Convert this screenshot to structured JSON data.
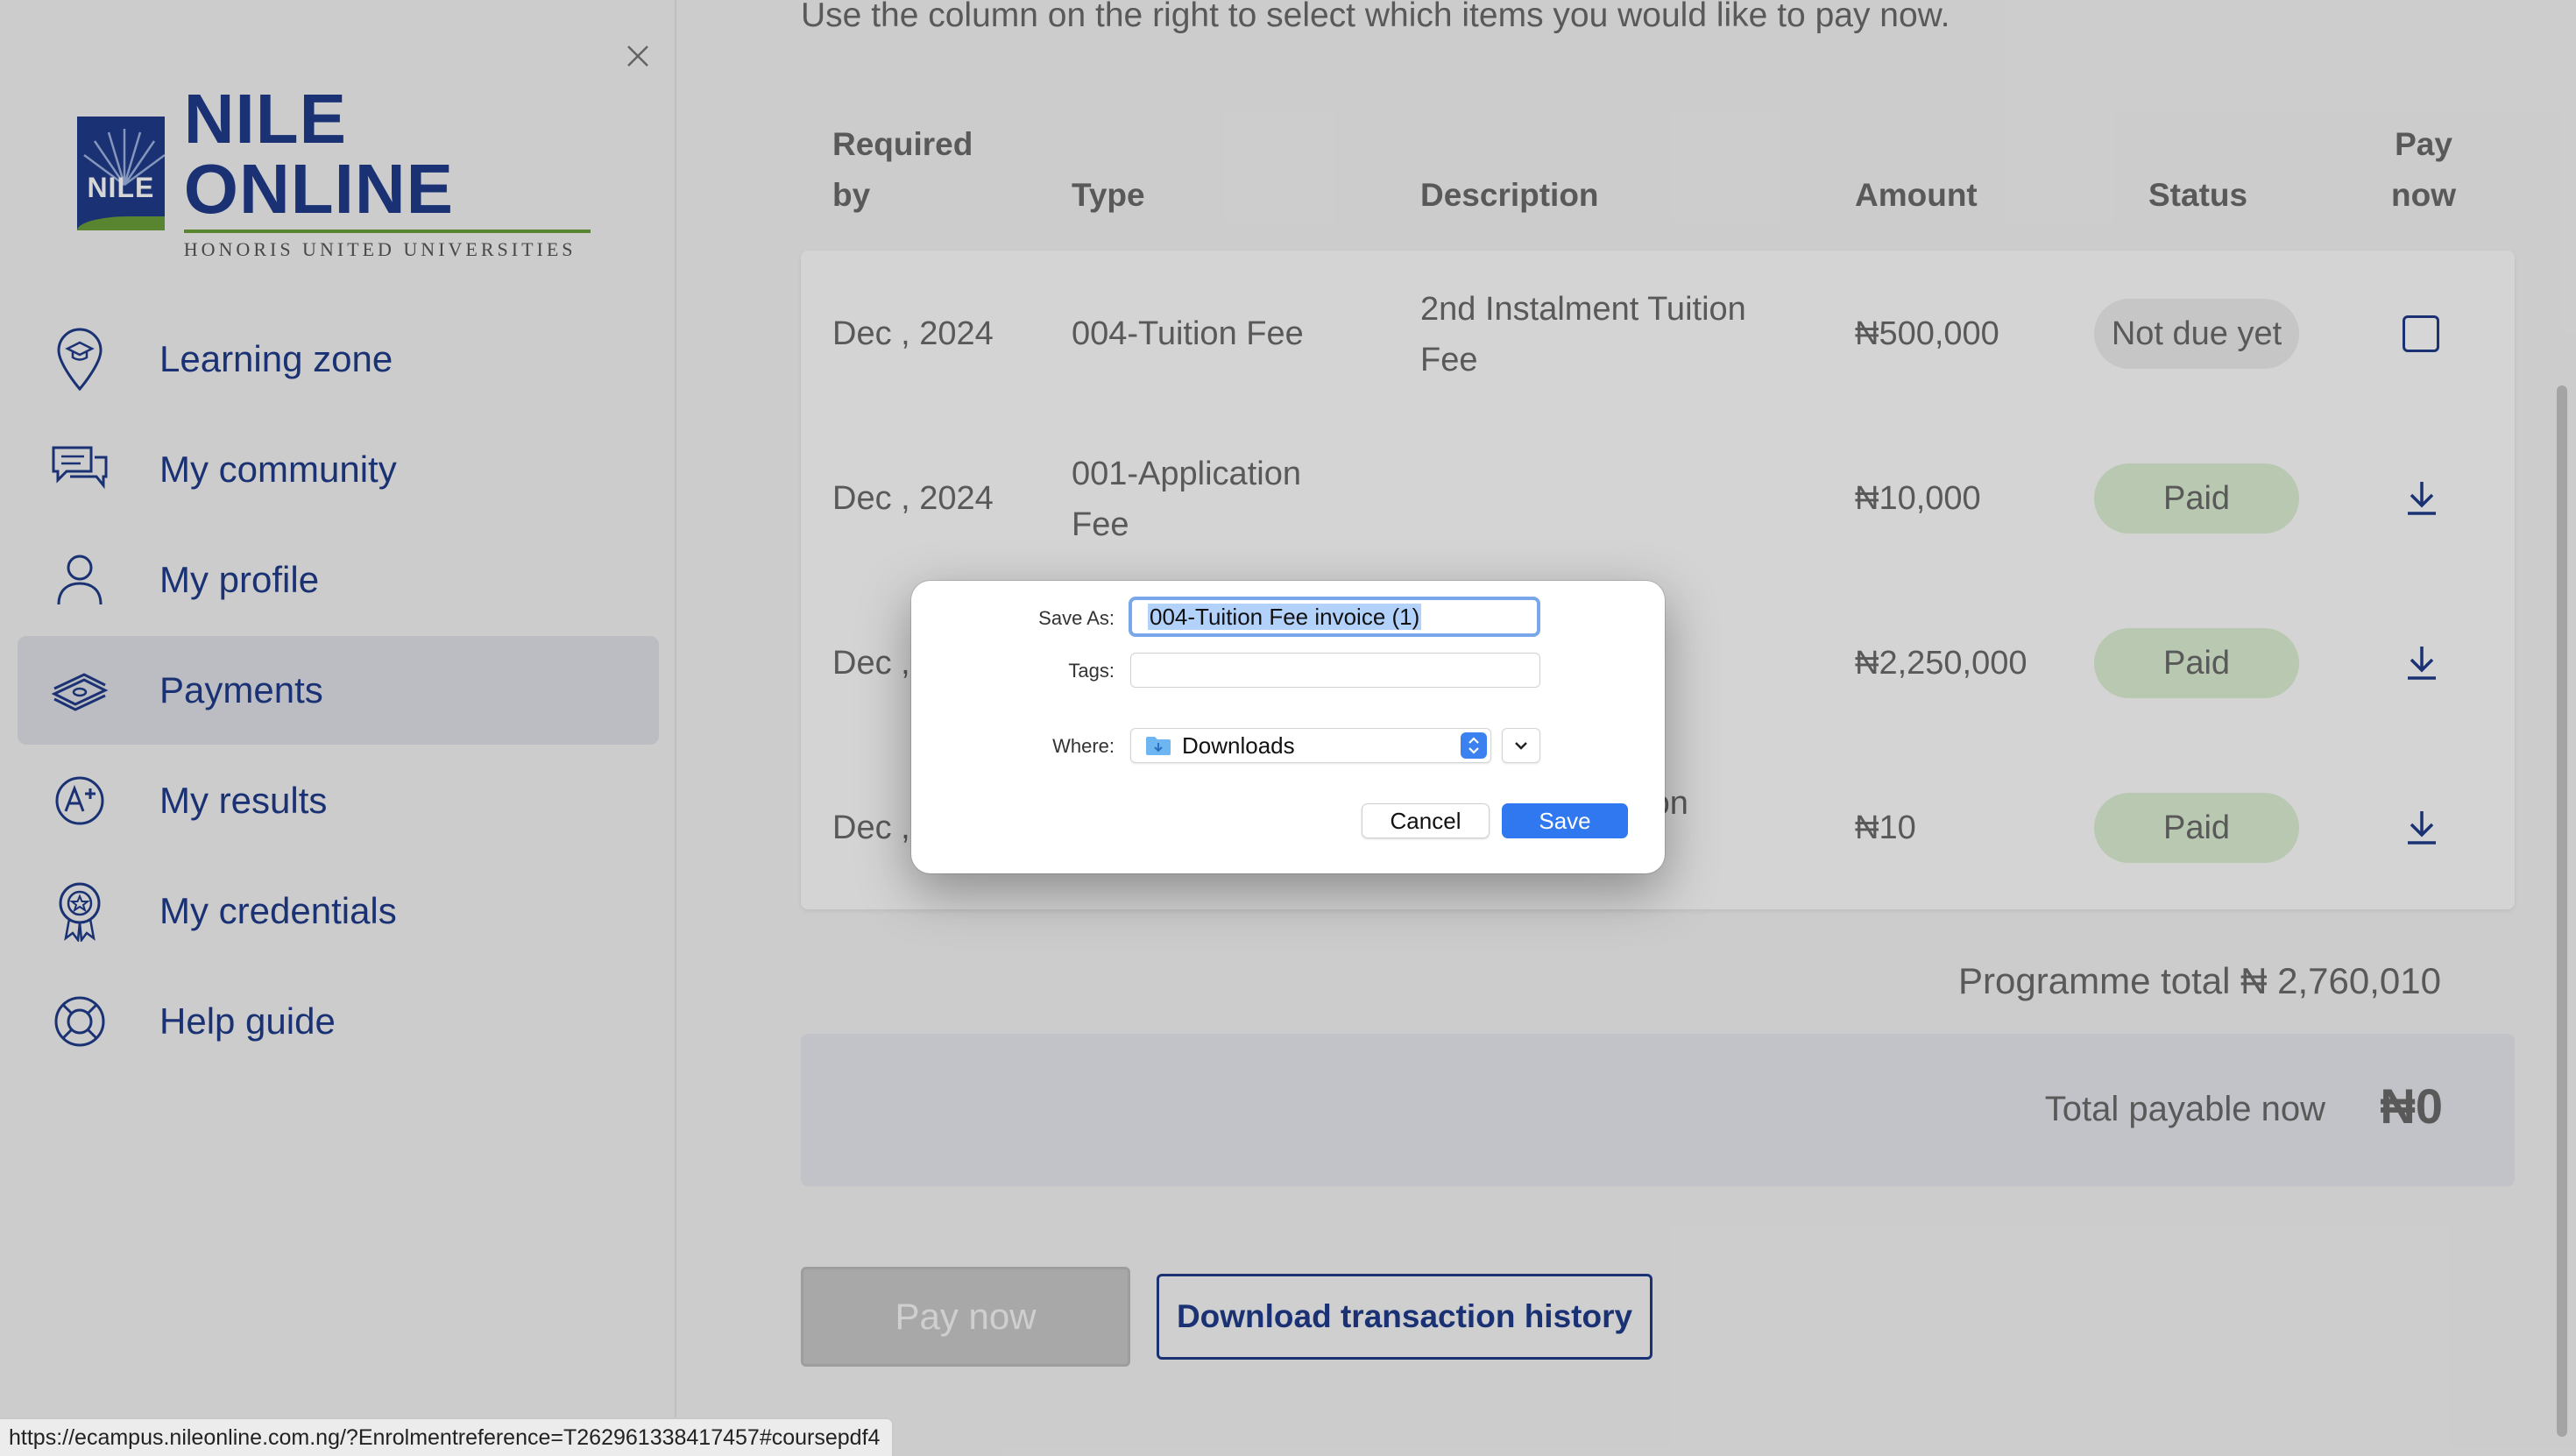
{
  "sidebar": {
    "logo": {
      "mark_text": "NILE",
      "title": "NILE ONLINE",
      "subtitle": "HONORIS UNITED UNIVERSITIES"
    },
    "items": [
      {
        "label": "Learning zone",
        "icon": "learning-zone-pin-icon",
        "active": false
      },
      {
        "label": "My community",
        "icon": "chat-bubbles-icon",
        "active": false
      },
      {
        "label": "My profile",
        "icon": "person-icon",
        "active": false
      },
      {
        "label": "Payments",
        "icon": "money-stack-icon",
        "active": true
      },
      {
        "label": "My results",
        "icon": "a-plus-grade-icon",
        "active": false
      },
      {
        "label": "My credentials",
        "icon": "award-badge-icon",
        "active": false
      },
      {
        "label": "Help guide",
        "icon": "lifebuoy-icon",
        "active": false
      }
    ],
    "accent_color": "#1f3c8a"
  },
  "main": {
    "intro": "Use the column on the right to select which items you would like to pay now.",
    "table": {
      "headers": {
        "required_by_line1": "Required",
        "required_by_line2": "by",
        "type": "Type",
        "description": "Description",
        "amount": "Amount",
        "status": "Status",
        "pay_now_line1": "Pay",
        "pay_now_line2": "now"
      },
      "rows": [
        {
          "required_by": "Dec , 2024",
          "type_line1": "004-Tuition Fee",
          "type_line2": "",
          "desc_line1": "2nd Instalment Tuition",
          "desc_line2": "Fee",
          "amount": "₦500,000",
          "status": "Not due yet",
          "action": "checkbox"
        },
        {
          "required_by": "Dec , 2024",
          "type_line1": "001-Application",
          "type_line2": "Fee",
          "desc_line1": "",
          "desc_line2": "",
          "amount": "₦10,000",
          "status": "Paid",
          "action": "download"
        },
        {
          "required_by": "Dec ,",
          "type_line1": "",
          "type_line2": "",
          "desc_line1": "",
          "desc_line2": "",
          "amount": "₦2,250,000",
          "status": "Paid",
          "action": "download"
        },
        {
          "required_by": "Dec ,",
          "type_line1": "",
          "type_line2": "",
          "desc_line1": "uition",
          "desc_line2": "",
          "amount": "₦10",
          "status": "Paid",
          "action": "download"
        }
      ]
    },
    "programme_total": "Programme total  ₦ 2,760,010",
    "total_payable_label": "Total payable now",
    "total_payable_value": "₦0",
    "pay_now_button": "Pay now",
    "download_history_button": "Download transaction history",
    "paid_color": "#dcefd3"
  },
  "status_bar": {
    "url": "https://ecampus.nileonline.com.ng/?Enrolmentreference=T262961338417457#coursepdf4"
  },
  "dialog": {
    "save_as_label": "Save As:",
    "save_as_value": "004-Tuition Fee invoice (1)",
    "tags_label": "Tags:",
    "tags_value": "",
    "where_label": "Where:",
    "where_value": "Downloads",
    "cancel_label": "Cancel",
    "save_label": "Save",
    "primary_color": "#2f78f0"
  }
}
